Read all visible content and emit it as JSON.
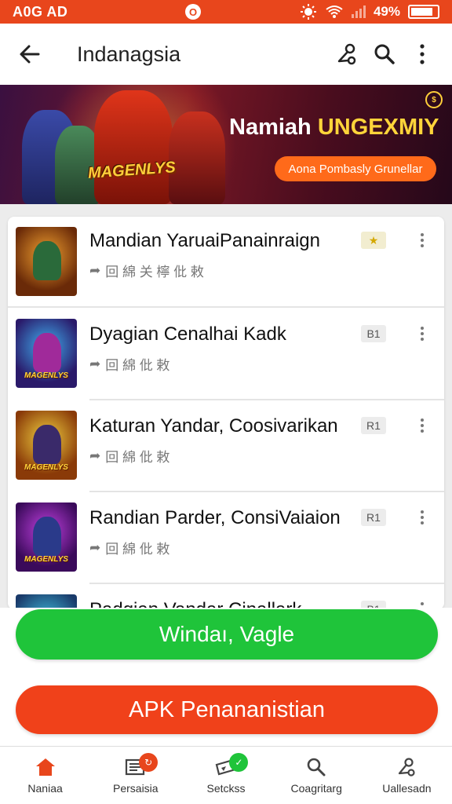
{
  "status_bar": {
    "time": "A0G AD",
    "battery": "49%",
    "battery_level": 0.85
  },
  "app_bar": {
    "title": "Indanagsia"
  },
  "banner": {
    "title_main": "Namiah ",
    "title_accent": "UNGEXMIY",
    "logo_text": "MAGENLYS",
    "cta_label": "Aona Pombasly Grunellar"
  },
  "list": {
    "items": [
      {
        "title": "Mandian YaruaiPanainraign",
        "meta": "回 綿 关 檸 仳 敕",
        "badge": "★"
      },
      {
        "title": "Dyagian Cenalhai Kadk",
        "meta": "回 綿 仳 敕",
        "badge": "B1"
      },
      {
        "title": "Katuran Yandar, Coosivarikan",
        "meta": "回 綿 仳 敕",
        "badge": "R1"
      },
      {
        "title": "Randian Parder, ConsiVaiaion",
        "meta": "回 綿 仳 敕",
        "badge": "R1"
      },
      {
        "title": "Padgian Vandar Cinallark",
        "meta": "",
        "badge": "B1"
      }
    ]
  },
  "actions": {
    "primary_label": "Windaı, Vagle",
    "secondary_label": "APK Penananistian"
  },
  "bottom_nav": {
    "items": [
      {
        "label": "Naniaa"
      },
      {
        "label": "Persaisia"
      },
      {
        "label": "Setckss"
      },
      {
        "label": "Coagritarg"
      },
      {
        "label": "Uallesadn"
      }
    ]
  },
  "colors": {
    "status_bar": "#e8461c",
    "primary_button": "#1fc43a",
    "secondary_button": "#f0411a",
    "nav_active": "#e8461c"
  }
}
